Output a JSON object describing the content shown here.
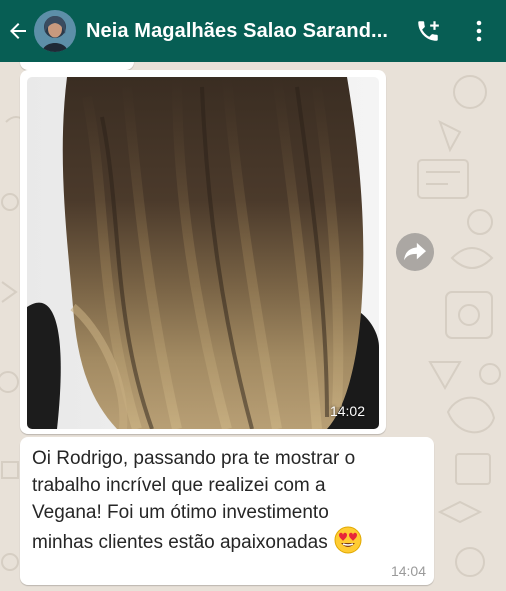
{
  "header": {
    "title": "Neia Magalhães Salao Sarand...",
    "back_icon": "arrow-left-icon",
    "call_icon": "add-call-icon",
    "menu_icon": "more-vertical-icon",
    "background": "#075e54"
  },
  "messages": [
    {
      "type": "image",
      "time": "14:02",
      "image_description_icon": "hair-photo"
    },
    {
      "type": "text",
      "text": "Oi Rodrigo, passando pra te mostrar o\ntrabalho incrível que realizei com a\nVegana! Foi um ótimo investimento\nminhas clientes estão apaixonadas",
      "emoji": "smiling-face-with-heart-eyes",
      "time": "14:04"
    }
  ],
  "forward_icon": "forward-arrow-icon",
  "colors": {
    "chat_background": "#e8e1d8",
    "bubble": "#ffffff",
    "timestamp": "#9a9a9a"
  }
}
